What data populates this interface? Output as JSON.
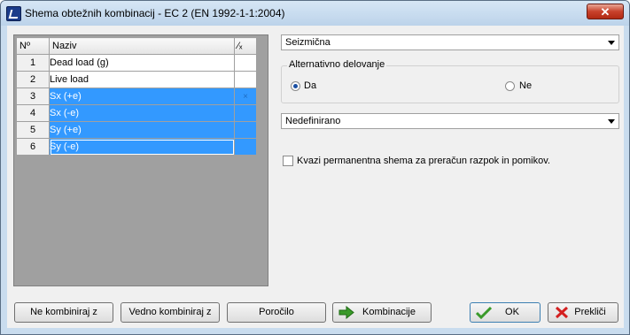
{
  "window": {
    "title": "Shema obtežnih kombinacij - EC 2 (EN 1992-1-1:2004)",
    "close_label": "✕"
  },
  "grid": {
    "headers": {
      "no": "Nº",
      "name": "Naziv",
      "exclude": "⁄ₓ"
    },
    "rows": [
      {
        "no": "1",
        "name": "Dead load (g)",
        "mark": "",
        "selected": false
      },
      {
        "no": "2",
        "name": "Live load",
        "mark": "",
        "selected": false
      },
      {
        "no": "3",
        "name": "Sx (+e)",
        "mark": "×",
        "selected": true
      },
      {
        "no": "4",
        "name": "Sx (-e)",
        "mark": "",
        "selected": true
      },
      {
        "no": "5",
        "name": "Sy (+e)",
        "mark": "",
        "selected": true
      },
      {
        "no": "6",
        "name": "Sy (-e)",
        "mark": "",
        "selected": true
      }
    ]
  },
  "right": {
    "situation_value": "Seizmična",
    "alt_group_label": "Alternativno delovanje",
    "radio_yes": "Da",
    "radio_no": "Ne",
    "radio_selected": "Da",
    "type_value": "Nedefinirano",
    "quasi_label": "Kvazi permanentna shema za preračun razpok in pomikov.",
    "quasi_checked": false
  },
  "buttons": {
    "never_combine": "Ne kombiniraj z",
    "always_combine": "Vedno kombiniraj z",
    "report": "Poročilo",
    "combinations": "Kombinacije",
    "ok": "OK",
    "cancel": "Prekliči"
  },
  "colors": {
    "selection": "#3399ff",
    "title_bg": "#c9dcee",
    "close_red": "#c8412b",
    "ok_green": "#3a9a2a",
    "cancel_red": "#d42020"
  }
}
